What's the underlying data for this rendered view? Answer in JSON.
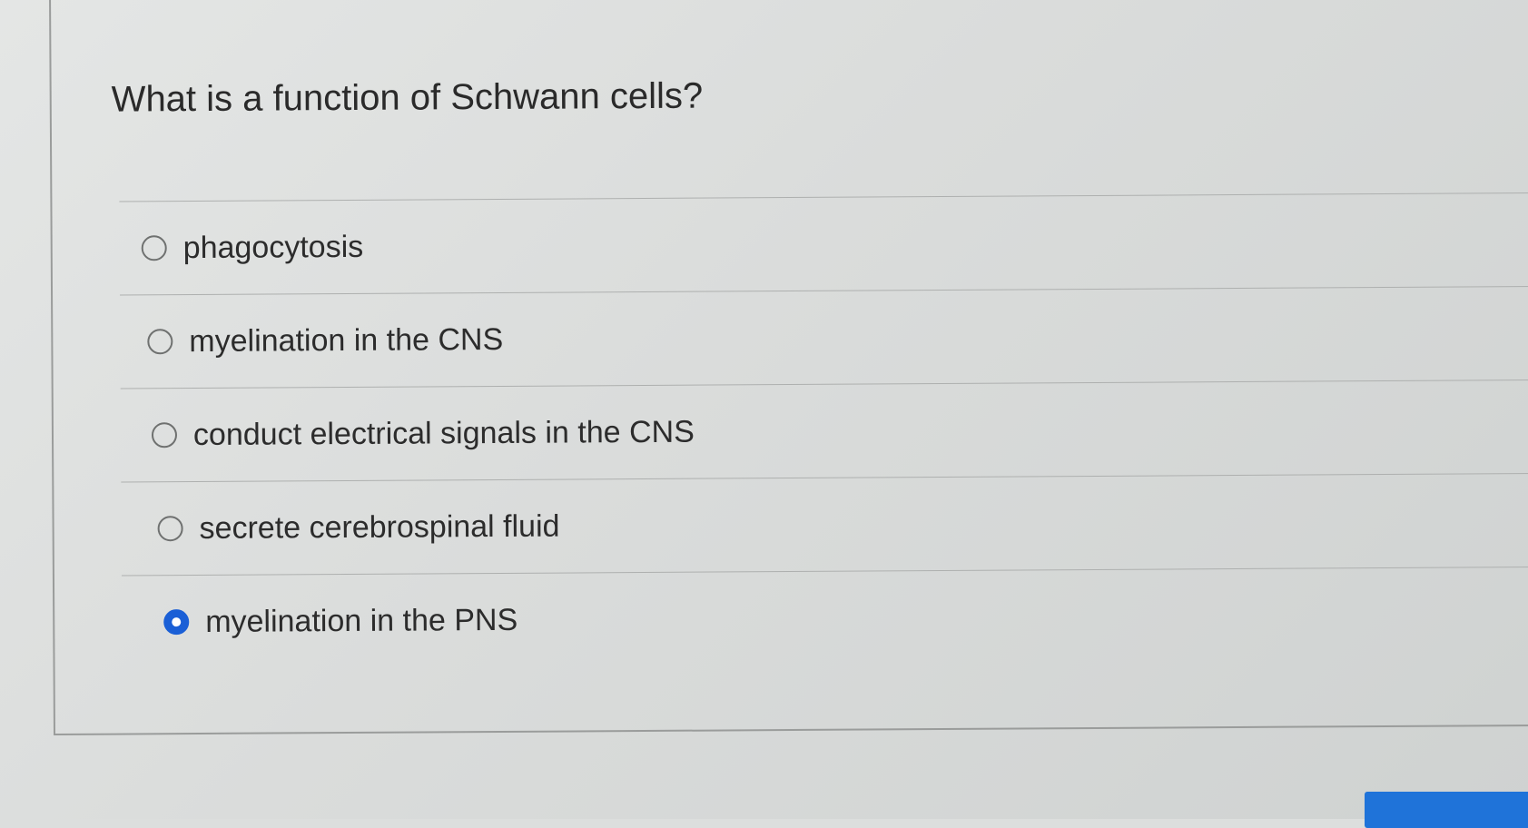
{
  "question": {
    "text": "What is a function of Schwann cells?"
  },
  "options": [
    {
      "label": "phagocytosis",
      "selected": false
    },
    {
      "label": "myelination in the CNS",
      "selected": false
    },
    {
      "label": "conduct electrical signals in the CNS",
      "selected": false
    },
    {
      "label": "secrete cerebrospinal fluid",
      "selected": false
    },
    {
      "label": "myelination in the PNS",
      "selected": true
    }
  ],
  "colors": {
    "selected_radio": "#1a5fd6",
    "button": "#1f73d9"
  },
  "icons": {
    "unselected": "radio-unchecked-icon",
    "selected": "radio-checked-icon"
  }
}
